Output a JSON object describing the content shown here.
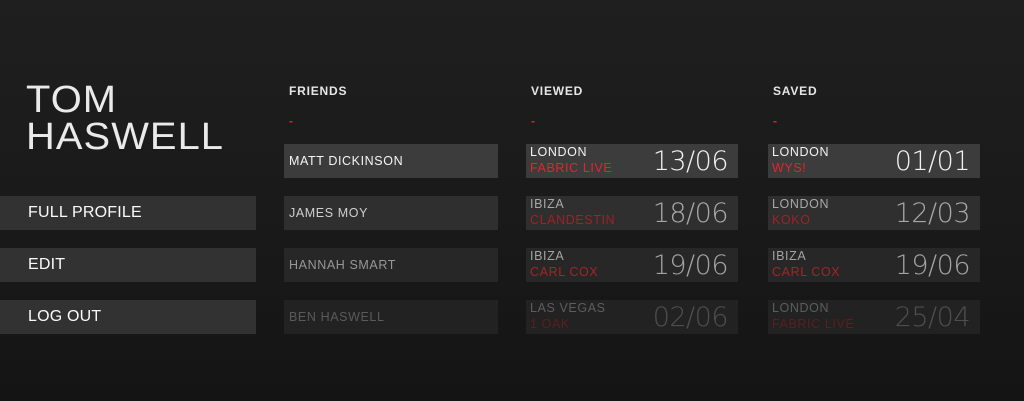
{
  "profile": {
    "first_name": "TOM",
    "last_name": "HASWELL"
  },
  "menu": [
    {
      "label": "FULL PROFILE"
    },
    {
      "label": "EDIT"
    },
    {
      "label": "LOG OUT"
    }
  ],
  "columns": {
    "friends": {
      "header": "FRIENDS",
      "dash": "-"
    },
    "viewed": {
      "header": "VIEWED",
      "dash": "-"
    },
    "saved": {
      "header": "SAVED",
      "dash": "-"
    }
  },
  "friends": [
    {
      "name": "MATT DICKINSON"
    },
    {
      "name": "JAMES MOY"
    },
    {
      "name": "HANNAH SMART"
    },
    {
      "name": "BEN HASWELL"
    }
  ],
  "viewed": [
    {
      "city": "LONDON",
      "venue": "FABRIC LIVE",
      "date": "13/06"
    },
    {
      "city": "IBIZA",
      "venue": "CLANDESTIN",
      "date": "18/06"
    },
    {
      "city": "IBIZA",
      "venue": "CARL COX",
      "date": "19/06"
    },
    {
      "city": "LAS VEGAS",
      "venue": "1 OAK",
      "date": "02/06"
    }
  ],
  "saved": [
    {
      "city": "LONDON",
      "venue": "WYS!",
      "date": "01/01"
    },
    {
      "city": "LONDON",
      "venue": "KOKO",
      "date": "12/03"
    },
    {
      "city": "IBIZA",
      "venue": "CARL COX",
      "date": "19/06"
    },
    {
      "city": "LONDON",
      "venue": "FABRIC LIVE",
      "date": "25/04"
    }
  ],
  "colors": {
    "accent": "#d6262b",
    "row_bg": "#323232"
  }
}
